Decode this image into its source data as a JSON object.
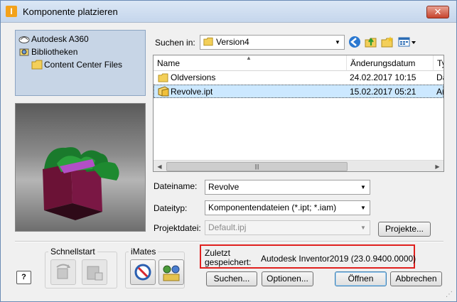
{
  "window": {
    "title": "Komponente platzieren",
    "close_label": "✕"
  },
  "tree": {
    "items": [
      {
        "label": "Autodesk A360",
        "icon": "a360-icon"
      },
      {
        "label": "Bibliotheken",
        "icon": "library-icon"
      },
      {
        "label": "Content Center Files",
        "icon": "folder-icon"
      }
    ]
  },
  "lookin": {
    "label": "Suchen in:",
    "value": "Version4"
  },
  "filelist": {
    "columns": [
      "Name",
      "Änderungsdatum",
      "Ty"
    ],
    "rows": [
      {
        "name": "Oldversions",
        "date": "24.02.2017 10:15",
        "type": "Da",
        "icon": "folder-icon"
      },
      {
        "name": "Revolve.ipt",
        "date": "15.02.2017 05:21",
        "type": "Au",
        "icon": "part-file-icon",
        "selected": true
      }
    ]
  },
  "filename": {
    "label": "Dateiname:",
    "value": "Revolve"
  },
  "filetype": {
    "label": "Dateityp:",
    "value": "Komponentendateien (*.ipt; *.iam)"
  },
  "project": {
    "label": "Projektdatei:",
    "value": "Default.ipj",
    "button": "Projekte..."
  },
  "quicklaunch": {
    "label": "Schnellstart"
  },
  "imates": {
    "label": "iMates"
  },
  "last_saved": {
    "label_line1": "Zuletzt",
    "label_line2": "gespeichert:",
    "value": "Autodesk Inventor2019 (23.0.9400.0000)"
  },
  "buttons": {
    "search": "Suchen...",
    "options": "Optionen...",
    "open": "Öffnen",
    "cancel": "Abbrechen"
  },
  "help_label": "?",
  "colors": {
    "highlight_box": "#e0201e",
    "selection": "#cce8ff",
    "tree_bg": "#c7d5e6"
  }
}
